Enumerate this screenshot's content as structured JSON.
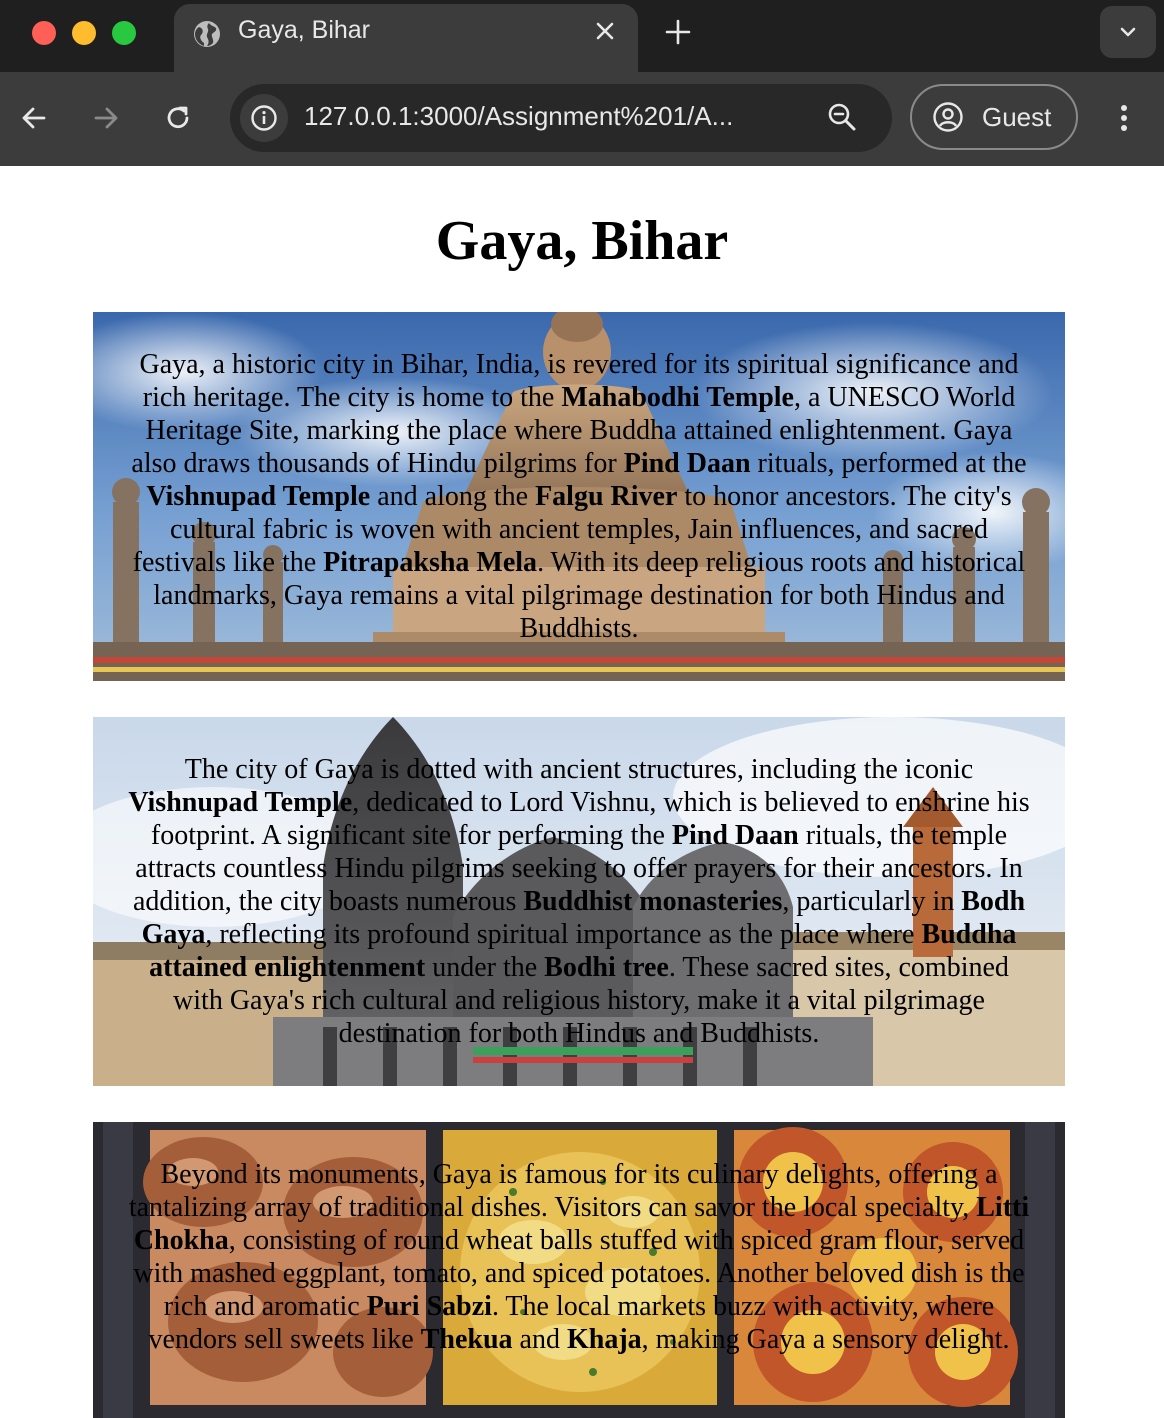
{
  "browser": {
    "tab_title": "Gaya, Bihar",
    "url": "127.0.0.1:3000/Assignment%201/A...",
    "profile_label": "Guest",
    "icons": [
      "globe-icon",
      "close-icon",
      "plus-icon",
      "chevron-down-icon",
      "back-arrow-icon",
      "forward-arrow-icon",
      "reload-icon",
      "info-icon",
      "zoom-icon",
      "profile-icon",
      "kebab-menu-icon"
    ]
  },
  "page": {
    "title": "Gaya, Bihar",
    "sections": [
      {
        "background": "Mahabodhi Buddha statue under blue sky",
        "parts": [
          {
            "t": "Gaya, a historic city in Bihar, India, is revered for its spiritual significance and rich heritage. The city is home to the "
          },
          {
            "b": "Mahabodhi Temple"
          },
          {
            "t": ", a UNESCO World Heritage Site, marking the place where Buddha attained enlightenment. Gaya also draws thousands of Hindu pilgrims for "
          },
          {
            "b": "Pind Daan"
          },
          {
            "t": " rituals, performed at the "
          },
          {
            "b": "Vishnupad Temple"
          },
          {
            "t": " and along the "
          },
          {
            "b": "Falgu River"
          },
          {
            "t": " to honor ancestors. The city's cultural fabric is woven with ancient temples, Jain influences, and sacred festivals like the "
          },
          {
            "b": "Pitrapaksha Mela"
          },
          {
            "t": ". With its deep religious roots and historical landmarks, Gaya remains a vital pilgrimage destination for both Hindus and Buddhists."
          }
        ]
      },
      {
        "background": "Vishnupad Temple spire",
        "parts": [
          {
            "t": "The city of Gaya is dotted with ancient structures, including the iconic "
          },
          {
            "b": "Vishnupad Temple"
          },
          {
            "t": ", dedicated to Lord Vishnu, which is believed to enshrine his footprint. A significant site for performing the "
          },
          {
            "b": "Pind Daan"
          },
          {
            "t": " rituals, the temple attracts countless Hindu pilgrims seeking to offer prayers for their ancestors. In addition, the city boasts numerous "
          },
          {
            "b": "Buddhist monasteries"
          },
          {
            "t": ", particularly in "
          },
          {
            "b": "Bodh Gaya"
          },
          {
            "t": ", reflecting its profound spiritual importance as the place where "
          },
          {
            "b": "Buddha attained enlightenment"
          },
          {
            "t": " under the "
          },
          {
            "b": "Bodhi tree"
          },
          {
            "t": ". These sacred sites, combined with Gaya's rich cultural and religious history, make it a vital pilgrimage destination for both Hindus and Buddhists."
          }
        ]
      },
      {
        "background": "Local dishes collage",
        "parts": [
          {
            "t": "Beyond its monuments, Gaya is famous for its culinary delights, offering a tantalizing array of traditional dishes. Visitors can savor the local specialty, "
          },
          {
            "b": "Litti Chokha"
          },
          {
            "t": ", consisting of round wheat balls stuffed with spiced gram flour, served with mashed eggplant, tomato, and spiced potatoes. Another beloved dish is the rich and aromatic "
          },
          {
            "b": "Puri Sabzi"
          },
          {
            "t": ". The local markets buzz with activity, where vendors sell sweets like "
          },
          {
            "b": "Thekua"
          },
          {
            "t": " and "
          },
          {
            "b": "Khaja"
          },
          {
            "t": ", making Gaya a sensory delight."
          }
        ]
      }
    ]
  }
}
